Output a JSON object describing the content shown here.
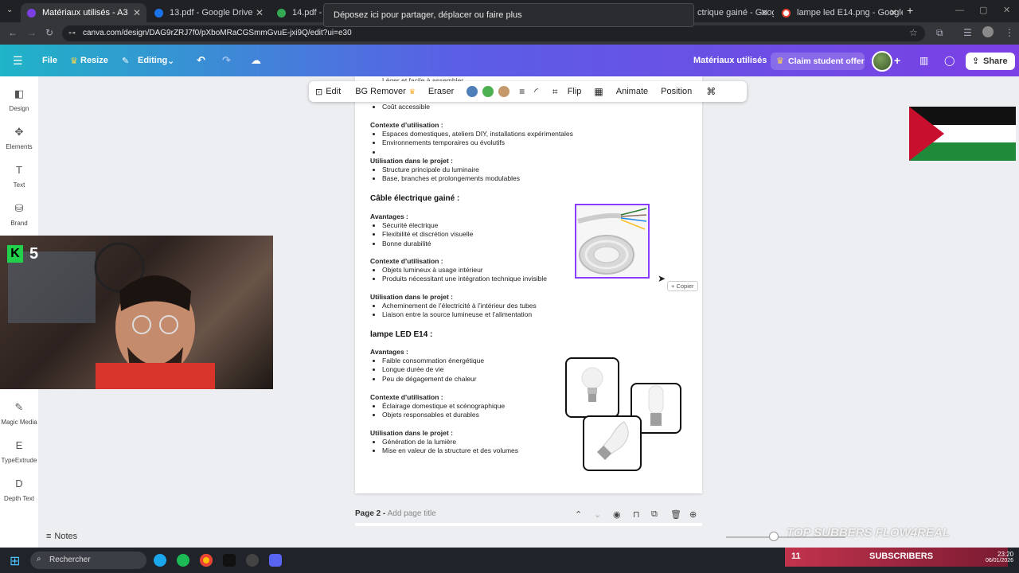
{
  "browser": {
    "tabs": [
      {
        "label": "Matériaux utilisés - A3",
        "active": true,
        "color": "#7b3fe4"
      },
      {
        "label": "13.pdf - Google Drive",
        "active": false,
        "color": "#1a73e8"
      },
      {
        "label": "14.pdf - Goo",
        "active": false,
        "color": "#34a853"
      },
      {
        "label": "ctrique gainé - Googl",
        "active": false,
        "color": "#ea4335"
      },
      {
        "label": "lampe led E14.png - Google Se",
        "active": false,
        "color": "#ea4335"
      }
    ],
    "new_tab": "+",
    "tooltip": "Déposez ici pour partager, déplacer ou faire plus",
    "url": "canva.com/design/DAG9rZRJ7f0/pXboMRaCGSmmGvuE-jxi9Q/edit?ui=e30"
  },
  "canva_header": {
    "file": "File",
    "resize": "Resize",
    "editing": "Editing",
    "doc_title": "Matériaux utilisés",
    "claim": "Claim student offer",
    "share": "Share"
  },
  "sidebar": [
    {
      "label": "Design",
      "icon": "design-icon",
      "glyph": "◧"
    },
    {
      "label": "Elements",
      "icon": "elements-icon",
      "glyph": "✥"
    },
    {
      "label": "Text",
      "icon": "text-icon",
      "glyph": "T"
    },
    {
      "label": "Brand",
      "icon": "brand-icon",
      "glyph": "⛁"
    },
    {
      "label": "Magic Media",
      "icon": "magic-media-icon",
      "glyph": "✎"
    },
    {
      "label": "TypeExtrude",
      "icon": "typeextrude-icon",
      "glyph": "E"
    },
    {
      "label": "Depth Text",
      "icon": "depth-text-icon",
      "glyph": "D"
    }
  ],
  "toolbar": {
    "edit": "Edit",
    "bg_remover": "BG Remover",
    "eraser": "Eraser",
    "colors": [
      "#4e7fb8",
      "#4caf50",
      "#c49a6c"
    ],
    "flip": "Flip",
    "animate": "Animate",
    "position": "Position"
  },
  "document": {
    "top_cut": "Léger et facile à assembler",
    "top_item": "Coût accessible",
    "ctx1_label": "Contexte d’utilisation :",
    "ctx1_items": [
      "Espaces domestiques, ateliers DIY, installations expérimentales",
      "Environnements temporaires ou évolutifs",
      ""
    ],
    "use1_label": "Utilisation dans le projet :",
    "use1_items": [
      "Structure principale du luminaire",
      "Base, branches et prolongements modulables"
    ],
    "sec2_title": "Câble électrique gainé :",
    "adv2_label": "Avantages :",
    "adv2_items": [
      "Sécurité électrique",
      "Flexibilité et discrétion visuelle",
      "Bonne durabilité"
    ],
    "ctx2_label": "Contexte d’utilisation :",
    "ctx2_items": [
      "Objets lumineux à usage intérieur",
      "Produits nécessitant une intégration technique invisible"
    ],
    "use2_label": "Utilisation dans le projet :",
    "use2_items": [
      "Acheminement de l’électricité à l’intérieur des tubes",
      "Liaison entre la source lumineuse et l’alimentation"
    ],
    "sec3_title": "lampe LED E14 :",
    "adv3_label": "Avantages :",
    "adv3_items": [
      "Faible consommation énergétique",
      "Longue durée de vie",
      "Peu de dégagement de chaleur"
    ],
    "ctx3_label": "Contexte d’utilisation :",
    "ctx3_items": [
      "Éclairage domestique et scénographique",
      "Objets responsables et durables"
    ],
    "use3_label": "Utilisation dans le projet :",
    "use3_items": [
      "Génération de la lumière",
      "Mise en valeur de la structure et des volumes"
    ],
    "copier": "+ Copier"
  },
  "page2": {
    "label": "Page 2 -",
    "placeholder": "Add page title"
  },
  "notes": "Notes",
  "webcam": {
    "counter": "5"
  },
  "taskbar": {
    "search": "Rechercher",
    "subscribers": "SUBSCRIBERS",
    "sub_count": "11",
    "clock_time": "23:20",
    "clock_date": "06/01/2026",
    "overlay": "TOP SUBBERS  FLOW4REAL"
  }
}
